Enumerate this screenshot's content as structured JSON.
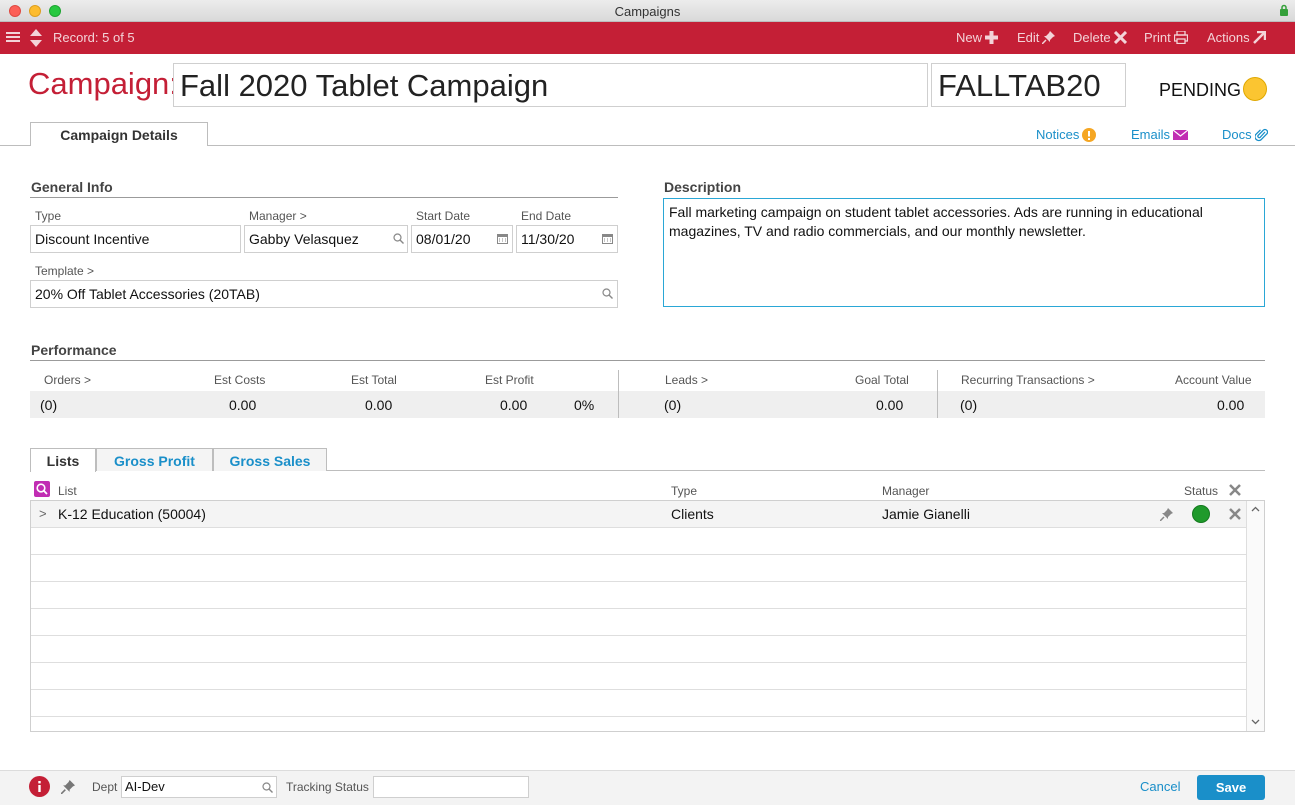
{
  "window": {
    "title": "Campaigns"
  },
  "toolbar": {
    "record": "Record: 5 of 5",
    "new": "New",
    "edit": "Edit",
    "delete": "Delete",
    "print": "Print",
    "actions": "Actions"
  },
  "header": {
    "label": "Campaign:",
    "name": "Fall 2020 Tablet Campaign",
    "code": "FALLTAB20",
    "status": "PENDING",
    "status_color": "#fbc531"
  },
  "tabs": {
    "main": "Campaign Details"
  },
  "links": {
    "notices": "Notices",
    "emails": "Emails",
    "docs": "Docs"
  },
  "general": {
    "title": "General Info",
    "type_label": "Type",
    "type": "Discount Incentive",
    "manager_label": "Manager >",
    "manager": "Gabby Velasquez",
    "start_label": "Start Date",
    "start": "08/01/20",
    "end_label": "End Date",
    "end": "11/30/20",
    "template_label": "Template >",
    "template": "20% Off Tablet Accessories  (20TAB)"
  },
  "description": {
    "title": "Description",
    "text": "Fall marketing campaign on student tablet accessories. Ads are running in educational magazines, TV and radio commercials, and our monthly newsletter."
  },
  "performance": {
    "title": "Performance",
    "orders_label": "Orders >",
    "orders": "(0)",
    "est_costs_label": "Est Costs",
    "est_costs": "0.00",
    "est_total_label": "Est Total",
    "est_total": "0.00",
    "est_profit_label": "Est Profit",
    "est_profit": "0.00",
    "profit_pct": "0%",
    "leads_label": "Leads >",
    "leads": "(0)",
    "goal_label": "Goal Total",
    "goal": "0.00",
    "recurring_label": "Recurring Transactions >",
    "recurring": "(0)",
    "account_label": "Account Value",
    "account": "0.00"
  },
  "list_tabs": {
    "lists": "Lists",
    "gross_profit": "Gross Profit",
    "gross_sales": "Gross Sales"
  },
  "grid": {
    "col_list": "List",
    "col_type": "Type",
    "col_manager": "Manager",
    "col_status": "Status",
    "rows": [
      {
        "expander": ">",
        "list": "K-12 Education  (50004)",
        "type": "Clients",
        "manager": "Jamie Gianelli",
        "status_color": "#1f9a2b"
      }
    ]
  },
  "footer": {
    "dept_label": "Dept",
    "dept": "AI-Dev",
    "tracking_label": "Tracking Status",
    "tracking": "",
    "cancel": "Cancel",
    "save": "Save"
  }
}
